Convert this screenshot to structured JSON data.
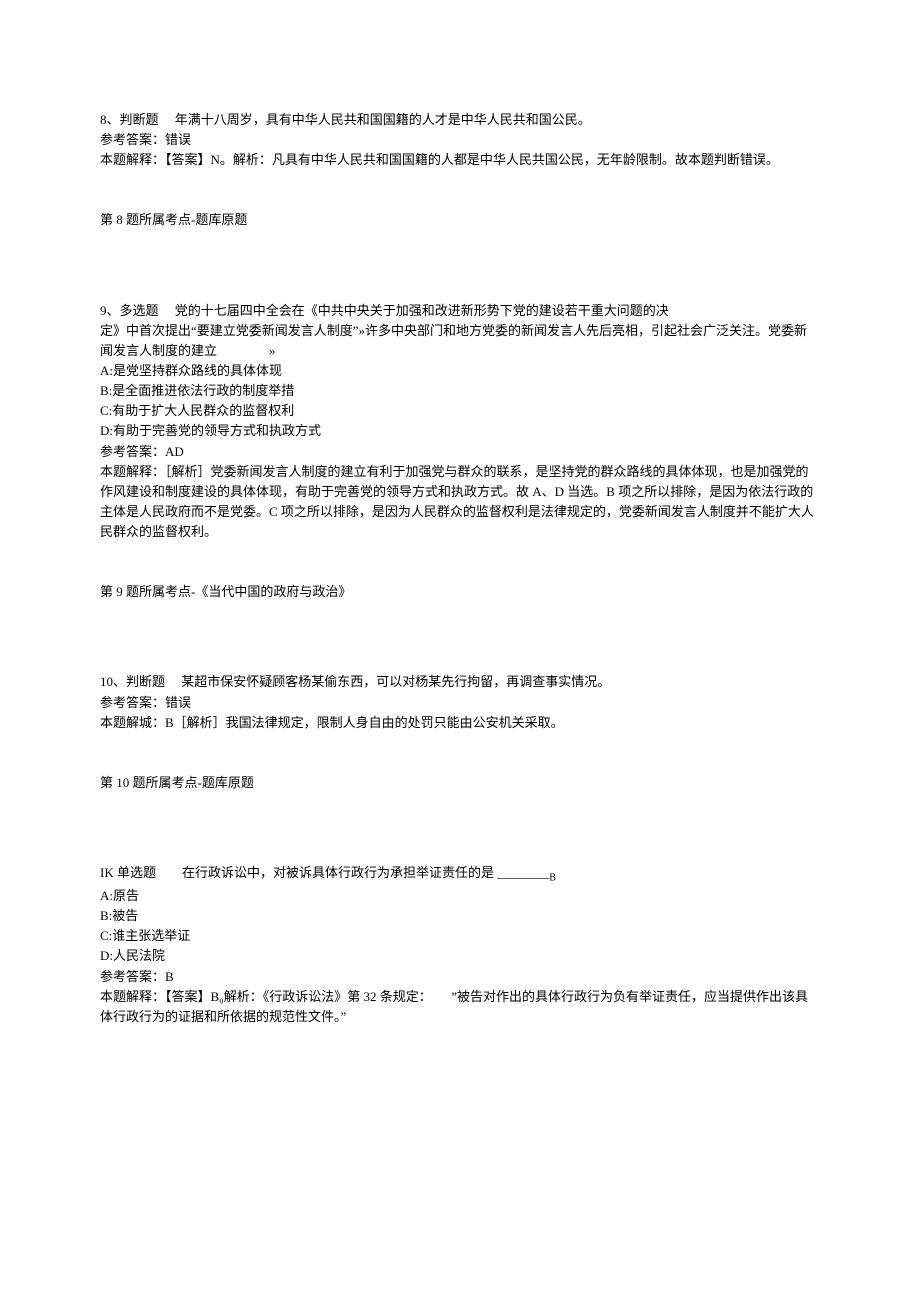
{
  "q8": {
    "header": "8、判断题  年满十八周岁，具有中华人民共和国国籍的人才是中华人民共和国公民。",
    "ansLabel": "参考答案：错误",
    "explain": "本题解释：【答案】N。解析：凡具有中华人民共和国国籍的人都是中华人民共国公民，无年龄限制。故本题判断错误。",
    "topic": "第 8 题所属考点-题库原题"
  },
  "q9": {
    "p1": "9、多选题  党的十七届四中全会在《中共中央关于加强和改进新形势下党的建设若干重大问题的决",
    "p2": "定》中首次提出“要建立党委新闻发言人制度”»许多中央部门和地方党委的新闻发言人先后亮相，引起社会广泛关注。党委新闻发言人制度的建立　　　　»",
    "optA": "A:是党坚持群众路线的具体体现",
    "optB": "B:是全面推进依法行政的制度举措",
    "optC": "C:有助于扩大人民群众的监督权利",
    "optD": "D:有助于完善党的领导方式和执政方式",
    "ansLabel": "参考答案：AD",
    "explain": "本题解释：［解析］党委新闻发言人制度的建立有利于加强党与群众的联系，是坚持党的群众路线的具体体现，也是加强党的作风建设和制度建设的具体体现，有助于完善党的领导方式和执政方式。故 A、D 当选。B 项之所以排除，是因为依法行政的主体是人民政府而不是党委。C 项之所以排除，是因为人民群众的监督权利是法律规定的，党委新闻发言人制度并不能扩大人民群众的监督权利。",
    "topic": "第 9 题所属考点-《当代中国的政府与政治》"
  },
  "q10": {
    "header": "10、判断题  某超市保安怀疑顾客杨某偷东西，可以对杨某先行拘留，再调查事实情况。",
    "ansLabel": "参考答案：错误",
    "explain": "本题解城：B［解析］我国法律规定，限制人身自由的处罚只能由公安机关采取。",
    "topic": "第 10 题所属考点-题库原题"
  },
  "q11": {
    "header": "IK 单选题  在行政诉讼中，对被诉具体行政行为承担举证责任的是 ________",
    "sub": "B",
    "optA": "A:原告",
    "optB": "B:被告",
    "optC": "C:谁主张选举证",
    "optD": "D:人民法院",
    "ansLabel": "参考答案：B",
    "explain": "本题解释：【答案】B₀解析：《行政诉讼法》第 32 条规定：　　”被告对作出的具体行政行为负有举证责任，应当提供作出该具体行政行为的证据和所依据的规范性文件。”"
  }
}
